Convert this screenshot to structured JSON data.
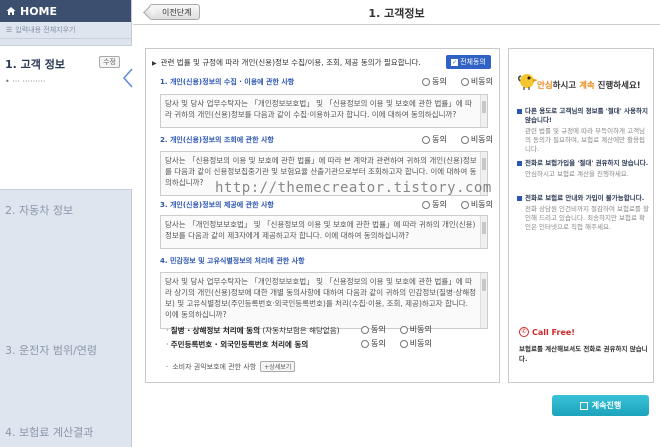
{
  "sidebar": {
    "home_label": "HOME",
    "reset_label": "입력내용 전체지우기",
    "step1": {
      "label": "1. 고객 정보",
      "badge": "수정",
      "sub": "• ··· ·········"
    },
    "step2": "2. 자동차 정보",
    "step3": "3. 운전자 범위/연령",
    "step4": "4. 보험료 계산결과"
  },
  "header": {
    "prev_label": "이전단계",
    "title": "1. 고객정보"
  },
  "consent": {
    "intro": "관련 법률 및 규정에 따라 개인(신용)정보 수집/이용, 조회, 제공 동의가 필요합니다.",
    "agree_all": "전체동의",
    "agree": "동의",
    "disagree": "비동의",
    "sections": [
      {
        "title": "1. 개인(신용)정보의 수집 · 이용에 관한 사항",
        "text": "당사 및 당사 업무수탁자는 「개인정보보호법」 및 「신용정보의 이용 및 보호에 관한 법률」에 따라 귀하의 개인(신용)정보를 다음과 같이 수집·이용하고자 합니다. 이에 대하여 동의하십니까?"
      },
      {
        "title": "2. 개인(신용)정보의 조회에 관한 사항",
        "text": "당사는 「신용정보의 이용 및 보호에 관한 법률」에 따라 본 계약과 관련하여 귀하의 개인(신용)정보를 다음과 같이 신용정보집중기관 및 보험요율 산출기관으로부터 조회하고자 합니다. 이에 대하여 동의하십니까?"
      },
      {
        "title": "3. 개인(신용)정보의 제공에 관한 사항",
        "text": "당사는 「개인정보보호법」 및 「신용정보의 이용 및 보호에 관한 법률」에 따라 귀하의 개인(신용)정보를 다음과 같이 제3자에게 제공하고자 합니다. 이에 대하여 동의하십니까?"
      },
      {
        "title": "4. 민감정보 및 고유식별정보의 처리에 관한 사항",
        "text": "당사 및 당사 업무수탁자는 「개인정보보호법」 및 「신용정보의 이용 및 보호에 관한 법률」에 따라 상기의 개인(신용)정보에 대한 개별 동의사항에 대하여 다음과 같이 귀하의 민감정보(질병·상해정보) 및 고유식별정보(주민등록번호·외국인등록번호)를 처리(수집·이용, 조회, 제공)하고자 합니다. 이에 동의하십니까?"
      }
    ],
    "sub_items": [
      {
        "label": "질병 · 상해정보 처리에 동의",
        "note": "(자동차보험은 해당없음)"
      },
      {
        "label": "주민등록번호 · 외국인등록번호 처리에 동의",
        "note": ""
      }
    ],
    "consumer_label": "소비자 권익보호에 관한 사항",
    "view_label": "+상세보기"
  },
  "info": {
    "head_pre": "안심",
    "head_mid": "하시고 ",
    "head_hl": "계속",
    "head_post": " 진행하세요!",
    "blocks": [
      {
        "q": "다른 용도로 고객님의 정보를 '절대' 사용하지 않습니다!",
        "a": "관련 법률 및 규정에 따라 부득이하게 고객님의 동의가 필요하며, 보험료 계산에만 활용됩니다."
      },
      {
        "q": "전화로 보험가입을 '절대' 권유하지 않습니다.",
        "a": "안심하시고 보험료 계산을 진행하세요."
      },
      {
        "q": "전화로 보험료 안내와 가입이 불가능합니다.",
        "a": "전화 상담원 인건비까지 절감하여 보험료를 할인해 드리고 있습니다. 죄송하지만 보험료 확인은 인터넷으로 직접 해주세요."
      }
    ],
    "call_free": "Call Free!",
    "call_text": "보험료를 계산해보셔도 전화로 권유하지 않습니다."
  },
  "continue_label": "계속진행",
  "watermark": "http://themecreator.tistory.com"
}
